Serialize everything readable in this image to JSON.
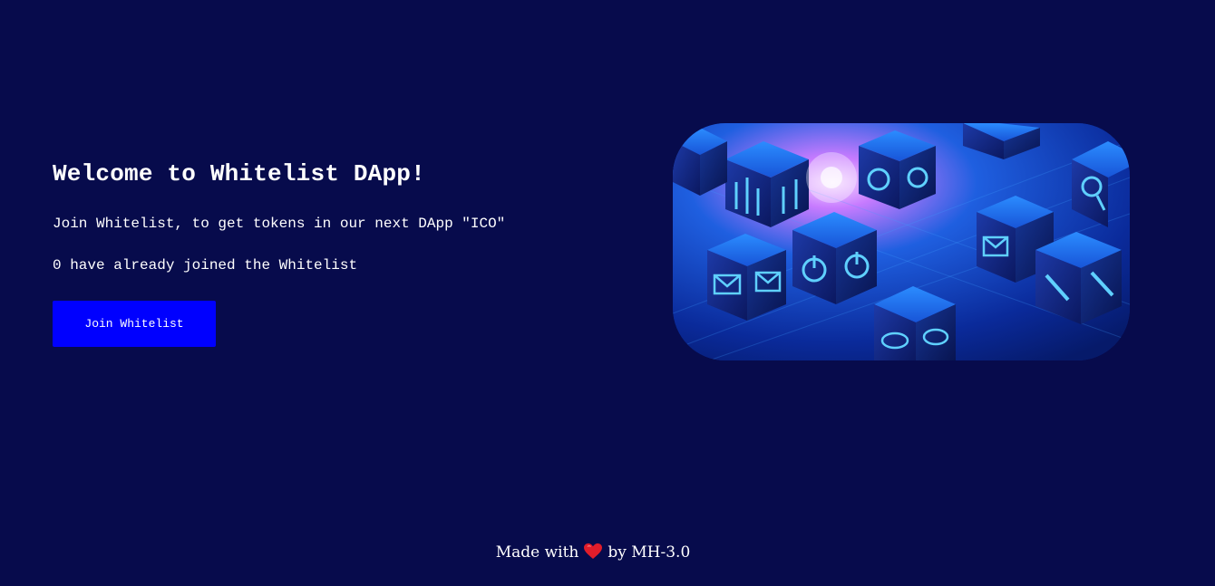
{
  "hero": {
    "title": "Welcome to Whitelist DApp!",
    "description": "Join Whitelist, to get tokens in our next DApp \"ICO\"",
    "count_text": "0 have already joined the Whitelist",
    "join_button_label": "Join Whitelist"
  },
  "image": {
    "icon": "blockchain-cubes-illustration"
  },
  "footer": {
    "made_with": "Made with",
    "heart_icon": "heart-icon",
    "by": "by MH-3.0"
  },
  "colors": {
    "background": "#070b4c",
    "button": "#0000ff",
    "text": "#ffffff",
    "heart": "#e11d2a"
  }
}
